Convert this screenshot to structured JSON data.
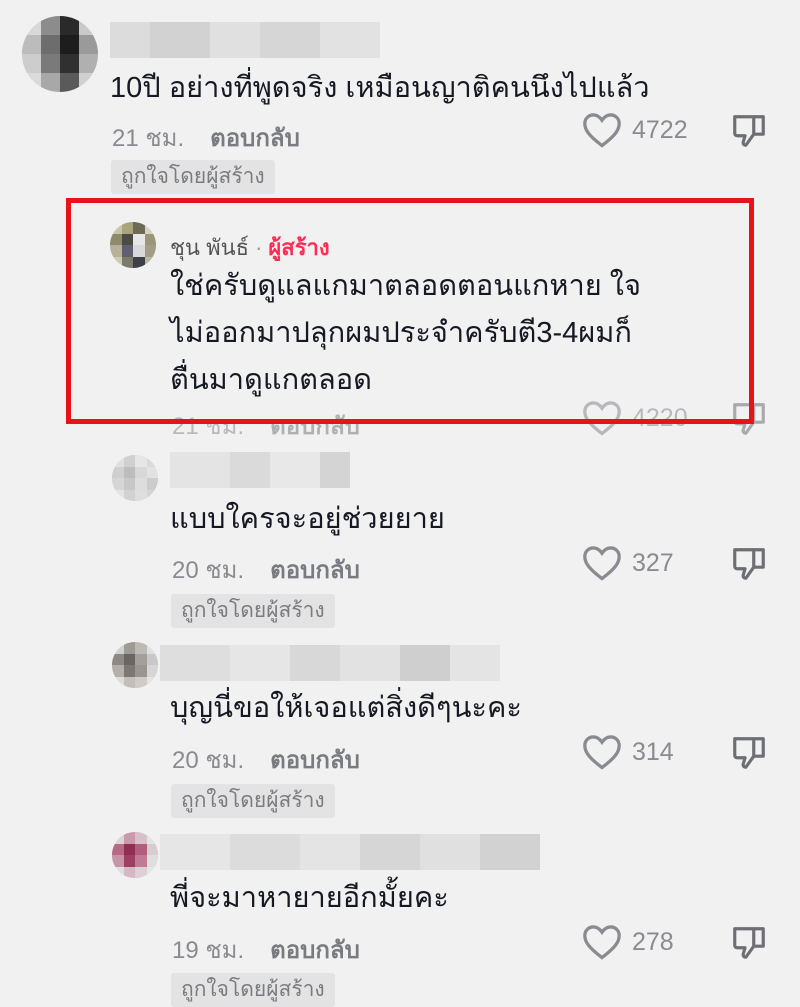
{
  "comments": [
    {
      "text": "10ปี อย่างที่พูดจริง เหมือนญาติคนนึงไปแล้ว",
      "time": "21 ชม.",
      "reply": "ตอบกลับ",
      "likes": "4722",
      "badge": "ถูกใจโดยผู้สร้าง"
    },
    {
      "author": "ชุน พันธ์",
      "separator": "·",
      "role": "ผู้สร้าง",
      "line1": "ใช่ครับดูแลแกมาตลอดตอนแกหาย ใจ",
      "line2": "ไม่ออกมาปลุกผมประจำครับตี3-4ผมก็",
      "line3": "ตื่นมาดูแกตลอด",
      "time": "21 ชม.",
      "reply": "ตอบกลับ",
      "likes": "4220"
    },
    {
      "text": "แบบใครจะอยู่ช่วยยาย",
      "time": "20 ชม.",
      "reply": "ตอบกลับ",
      "likes": "327",
      "badge": "ถูกใจโดยผู้สร้าง"
    },
    {
      "text": "บุญนี่ขอให้เจอแต่สิ่งดีๆนะคะ",
      "time": "20 ชม.",
      "reply": "ตอบกลับ",
      "likes": "314",
      "badge": "ถูกใจโดยผู้สร้าง"
    },
    {
      "text": "พี่จะมาหายายอีกมั้ยคะ",
      "time": "19 ชม.",
      "reply": "ตอบกลับ",
      "likes": "278",
      "badge": "ถูกใจโดยผู้สร้าง"
    }
  ],
  "icons": {
    "like": "heart-icon",
    "dislike": "thumbs-down-icon"
  },
  "colors": {
    "highlight": "#e8131a",
    "creator_role": "#fe2c55",
    "meta": "#8a8b91"
  }
}
